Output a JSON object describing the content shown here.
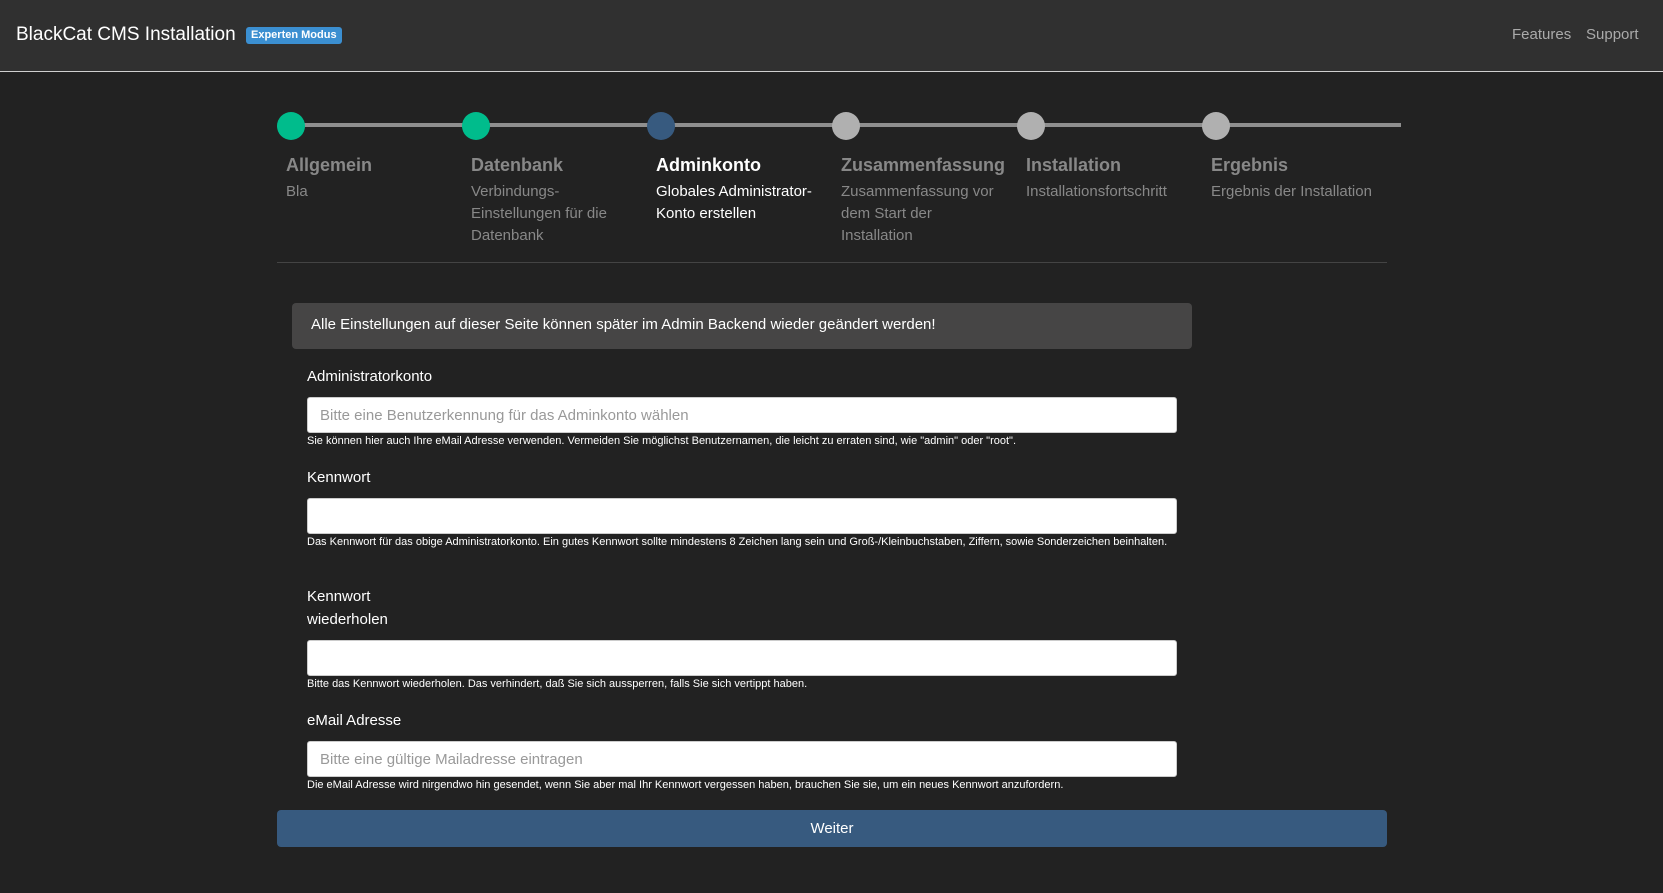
{
  "navbar": {
    "brand": "BlackCat CMS Installation",
    "badge": "Experten Modus",
    "links": [
      "Features",
      "Support"
    ]
  },
  "stepper": {
    "colors": {
      "done": "#00bc8c",
      "active": "#375a7f",
      "pending": "#b0b0b0"
    },
    "steps": [
      {
        "title": "Allgemein",
        "desc": "Bla",
        "status": "done"
      },
      {
        "title": "Datenbank",
        "desc": "Verbindungs-Einstellungen für die Datenbank",
        "status": "done"
      },
      {
        "title": "Adminkonto",
        "desc": "Globales Administrator-Konto erstellen",
        "status": "active"
      },
      {
        "title": "Zusammenfassung",
        "desc": "Zusammenfassung vor dem Start der Installation",
        "status": "pending"
      },
      {
        "title": "Installation",
        "desc": "Installationsfortschritt",
        "status": "pending"
      },
      {
        "title": "Ergebnis",
        "desc": "Ergebnis der Installation",
        "status": "pending"
      }
    ]
  },
  "alert": "Alle Einstellungen auf dieser Seite können später im Admin Backend wieder geändert werden!",
  "form": {
    "admin": {
      "label": "Administratorkonto",
      "placeholder": "Bitte eine Benutzerkennung für das Adminkonto wählen",
      "value": "",
      "help": "Sie können hier auch Ihre eMail Adresse verwenden. Vermeiden Sie möglichst Benutzernamen, die leicht zu erraten sind, wie \"admin\" oder \"root\"."
    },
    "password": {
      "label": "Kennwort",
      "placeholder": "",
      "value": "",
      "help": "Das Kennwort für das obige Administratorkonto. Ein gutes Kennwort sollte mindestens 8 Zeichen lang sein und Groß-/Kleinbuchstaben, Ziffern, sowie Sonderzeichen beinhalten."
    },
    "password_repeat": {
      "label_line1": "Kennwort",
      "label_line2": "wiederholen",
      "placeholder": "",
      "value": "",
      "help": "Bitte das Kennwort wiederholen. Das verhindert, daß Sie sich aussperren, falls Sie sich vertippt haben."
    },
    "email": {
      "label": "eMail Adresse",
      "placeholder": "Bitte eine gültige Mailadresse eintragen",
      "value": "",
      "help": "Die eMail Adresse wird nirgendwo hin gesendet, wenn Sie aber mal Ihr Kennwort vergessen haben, brauchen Sie sie, um ein neues Kennwort anzufordern."
    },
    "submit_label": "Weiter"
  }
}
